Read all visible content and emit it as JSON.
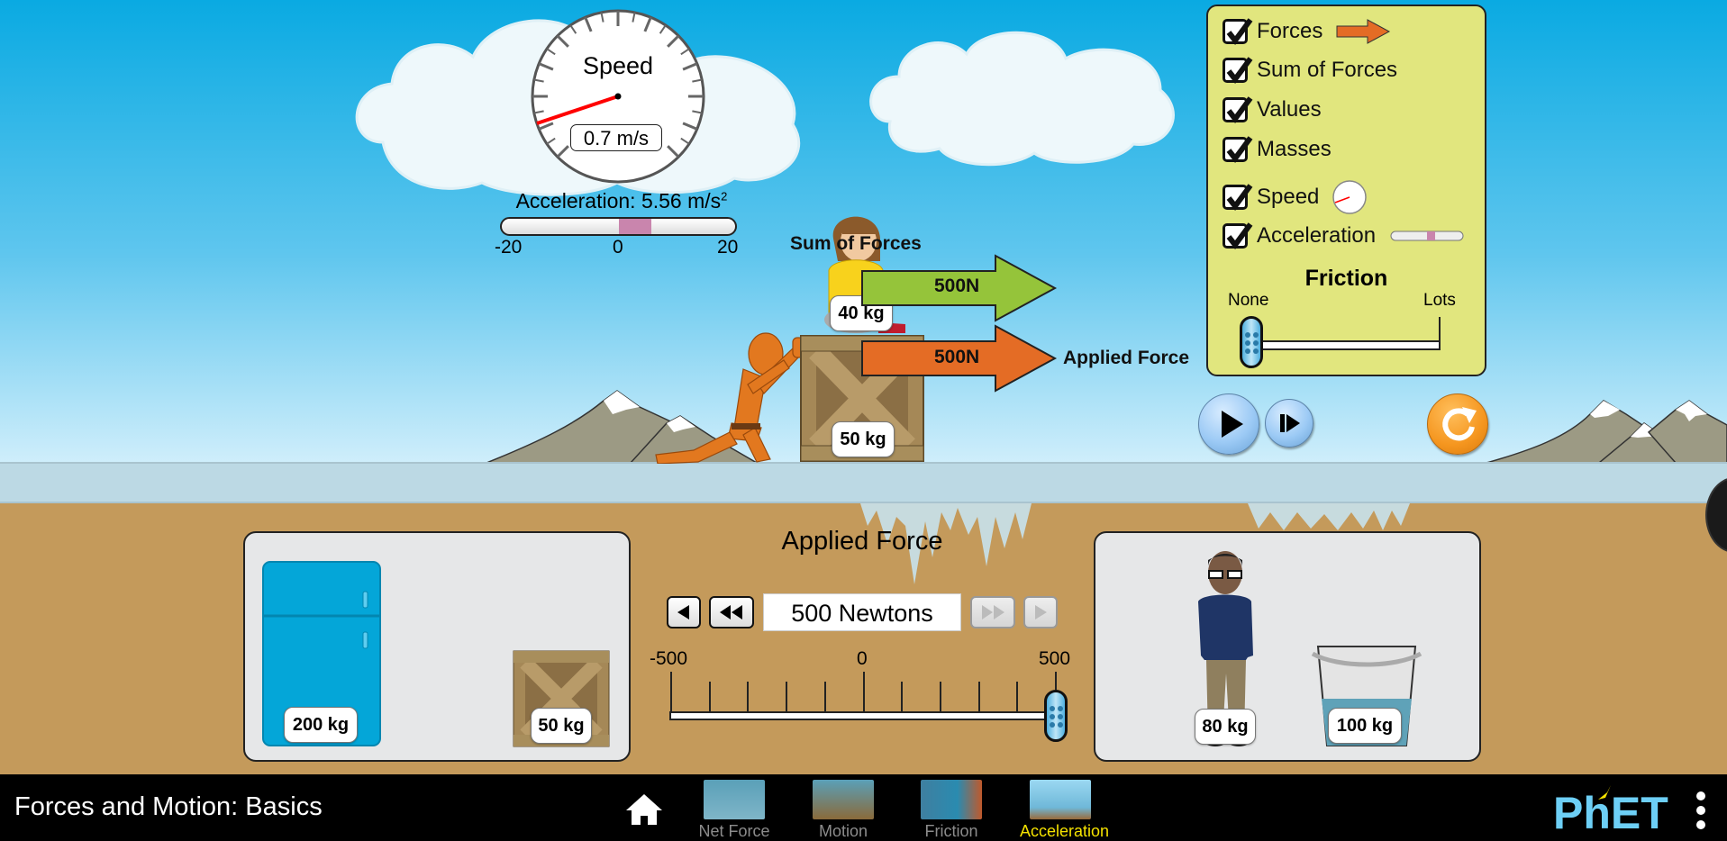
{
  "app": {
    "title": "Forces and Motion: Basics",
    "brand_logo": "PhET"
  },
  "speedometer": {
    "title": "Speed",
    "readout": "0.7 m/s",
    "value_mps": 0.7,
    "needle_color": "#ff0000"
  },
  "acceleration_meter": {
    "label_prefix": "Acceleration: ",
    "value_text": "5.56 m/s",
    "exponent": "2",
    "value": 5.56,
    "min": -20,
    "max": 20,
    "tick_labels": [
      "-20",
      "0",
      "20"
    ],
    "fill_color": "#c985ad"
  },
  "scene": {
    "sum_of_forces_label": "Sum of Forces",
    "sum_of_forces_value": "500N",
    "applied_force_label": "Applied Force",
    "applied_force_value": "500N",
    "sum_arrow_color": "#95c43a",
    "applied_arrow_color": "#e46c25",
    "stack": [
      {
        "name": "girl",
        "mass": "40 kg"
      },
      {
        "name": "crate",
        "mass": "50 kg"
      }
    ]
  },
  "control_panel": {
    "checkboxes": [
      {
        "label": "Forces",
        "checked": true,
        "icon": "force-arrow-icon"
      },
      {
        "label": "Sum of Forces",
        "checked": true
      },
      {
        "label": "Values",
        "checked": true
      },
      {
        "label": "Masses",
        "checked": true
      },
      {
        "label": "Speed",
        "checked": true,
        "icon": "speedometer-icon"
      },
      {
        "label": "Acceleration",
        "checked": true,
        "icon": "acceleration-meter-icon"
      }
    ],
    "friction": {
      "title": "Friction",
      "min_label": "None",
      "max_label": "Lots",
      "value_fraction": 0
    },
    "background_color": "#e1e67e"
  },
  "playback": {
    "play_icon": "play-icon",
    "step_icon": "step-forward-icon",
    "reset_icon": "reset-icon",
    "playing": false
  },
  "applied_force_control": {
    "title": "Applied Force",
    "value_text": "500 Newtons",
    "value": 500,
    "min": -500,
    "max": 500,
    "tick_labels": [
      "-500",
      "0",
      "500"
    ],
    "decrement_icon": "triangle-left-icon",
    "decrement_large_icon": "double-triangle-left-icon",
    "increment_large_icon": "double-triangle-right-icon",
    "increment_icon": "triangle-right-icon",
    "increment_disabled": true
  },
  "left_tray": {
    "items": [
      {
        "name": "refrigerator",
        "mass": "200 kg"
      },
      {
        "name": "crate",
        "mass": "50 kg"
      }
    ]
  },
  "right_tray": {
    "items": [
      {
        "name": "man",
        "mass": "80 kg"
      },
      {
        "name": "water-bucket",
        "mass": "100 kg"
      }
    ]
  },
  "navbar": {
    "home_icon": "home-icon",
    "screens": [
      {
        "label": "Net Force",
        "active": false
      },
      {
        "label": "Motion",
        "active": false
      },
      {
        "label": "Friction",
        "active": false
      },
      {
        "label": "Acceleration",
        "active": true
      }
    ],
    "active_color": "#f5e200",
    "menu_icon": "kebab-menu-icon"
  }
}
